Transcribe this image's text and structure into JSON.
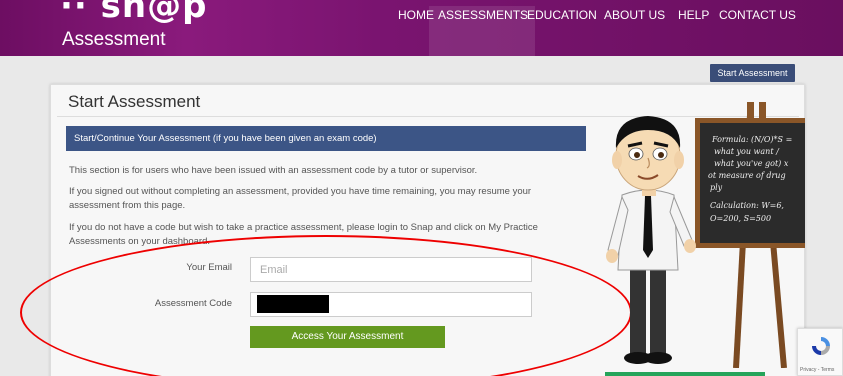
{
  "header": {
    "logo_mark": "·· sn@p",
    "logo_sub": "Assessment",
    "nav": [
      {
        "label": "HOME"
      },
      {
        "label": "ASSESSMENTS"
      },
      {
        "label": "EDUCATION"
      },
      {
        "label": "ABOUT US"
      },
      {
        "label": "HELP"
      },
      {
        "label": "CONTACT US"
      }
    ],
    "active_nav": "ASSESSMENTS"
  },
  "top_button": "Start Assessment",
  "card": {
    "title": "Start Assessment",
    "panel_heading": "Start/Continue Your Assessment (if you have been given an exam code)",
    "paragraphs": [
      "This section is for users who have been issued with an assessment code by a tutor or supervisor.",
      "If you signed out without completing an assessment, provided you have time remaining, you may resume your assessment from this page.",
      "If you do not have a code but wish to take a practice assessment, please login to Snap and click on My Practice Assessments on your dashboard."
    ]
  },
  "form": {
    "email_label": "Your Email",
    "email_placeholder": "Email",
    "code_label": "Assessment Code",
    "submit_label": "Access Your Assessment"
  },
  "chalkboard": {
    "lines": [
      "Formula: (N/O)*S =",
      "what you want /",
      "what you've got) x",
      "ot measure of drug",
      "ply",
      "Calculation: W=6,",
      "O=200, S=500"
    ]
  },
  "recaptcha": {
    "label": "Privacy - Terms"
  },
  "colors": {
    "header_purple": "#7a1470",
    "panel_blue": "#3c5586",
    "button_green": "#64991f",
    "annotation_red": "#e00000"
  }
}
